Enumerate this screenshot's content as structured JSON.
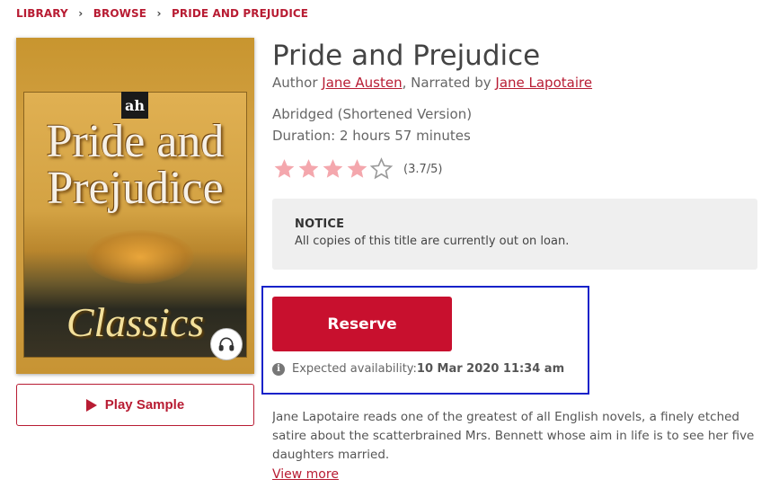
{
  "breadcrumb": {
    "items": [
      "LIBRARY",
      "BROWSE",
      "PRIDE AND PREJUDICE"
    ],
    "separator_icon": "chevron-right-icon"
  },
  "cover": {
    "publisher_logo": "ah",
    "title_line1": "Pride and",
    "title_line2": "Prejudice",
    "series": "Classics",
    "badge_icon": "headphones-icon"
  },
  "play_sample": {
    "icon": "play-icon",
    "label": "Play Sample"
  },
  "book": {
    "title": "Pride and Prejudice",
    "author_prefix": "Author ",
    "author": "Jane Austen",
    "narrator_prefix": ", Narrated by ",
    "narrator": "Jane Lapotaire",
    "edition": "Abridged (Shortened Version)",
    "duration": "Duration: 2 hours 57 minutes"
  },
  "rating": {
    "value": 3.7,
    "max": 5,
    "filled_stars": 4,
    "label": "(3.7/5)",
    "filled_color": "#f4a7ad",
    "empty_color": "#9a9a9a"
  },
  "notice": {
    "heading": "NOTICE",
    "body": "All copies of this title are currently out on loan."
  },
  "reserve": {
    "button_label": "Reserve",
    "availability_label": "Expected availability:",
    "availability_date": "10 Mar 2020 11:34 am",
    "info_icon": "info-icon",
    "button_color": "#c8102e"
  },
  "description": {
    "text": "Jane Lapotaire reads one of the greatest of all English novels, a finely etched satire about the scatterbrained Mrs. Bennett whose aim in life is to see her five daughters married.",
    "view_more": "View more"
  },
  "colors": {
    "accent": "#b81c33",
    "highlight_border": "#1722c9"
  }
}
